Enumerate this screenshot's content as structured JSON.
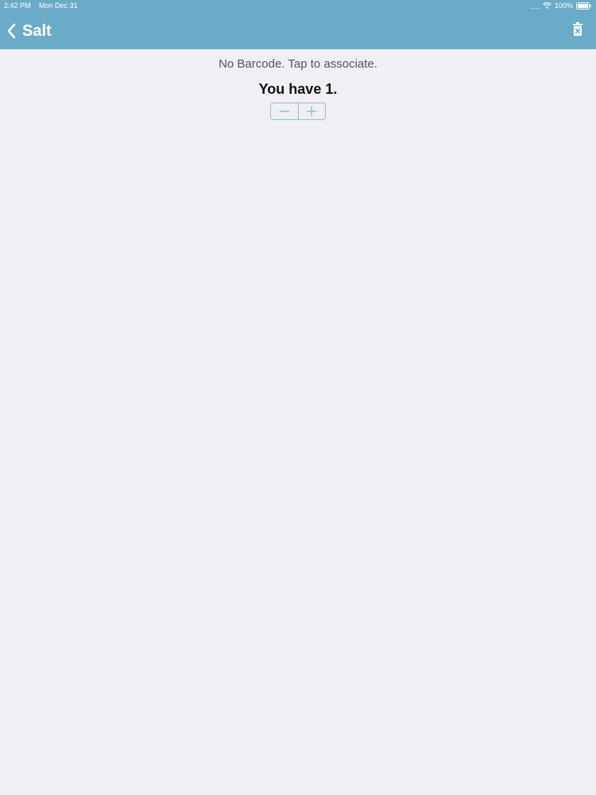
{
  "status_bar": {
    "time": "2:42 PM",
    "date": "Mon Dec 31",
    "battery": "100%"
  },
  "nav": {
    "title": "Salt",
    "back_icon": "chevron-left-icon",
    "trash_icon": "trash-icon"
  },
  "item": {
    "barcode_message": "No Barcode. Tap to associate.",
    "count_text": "You have 1."
  },
  "stepper": {
    "decrement_icon": "minus-icon",
    "increment_icon": "plus-icon"
  },
  "colors": {
    "header": "#6aacc7",
    "background": "#efeff4",
    "accent": "#8fbfd3"
  }
}
